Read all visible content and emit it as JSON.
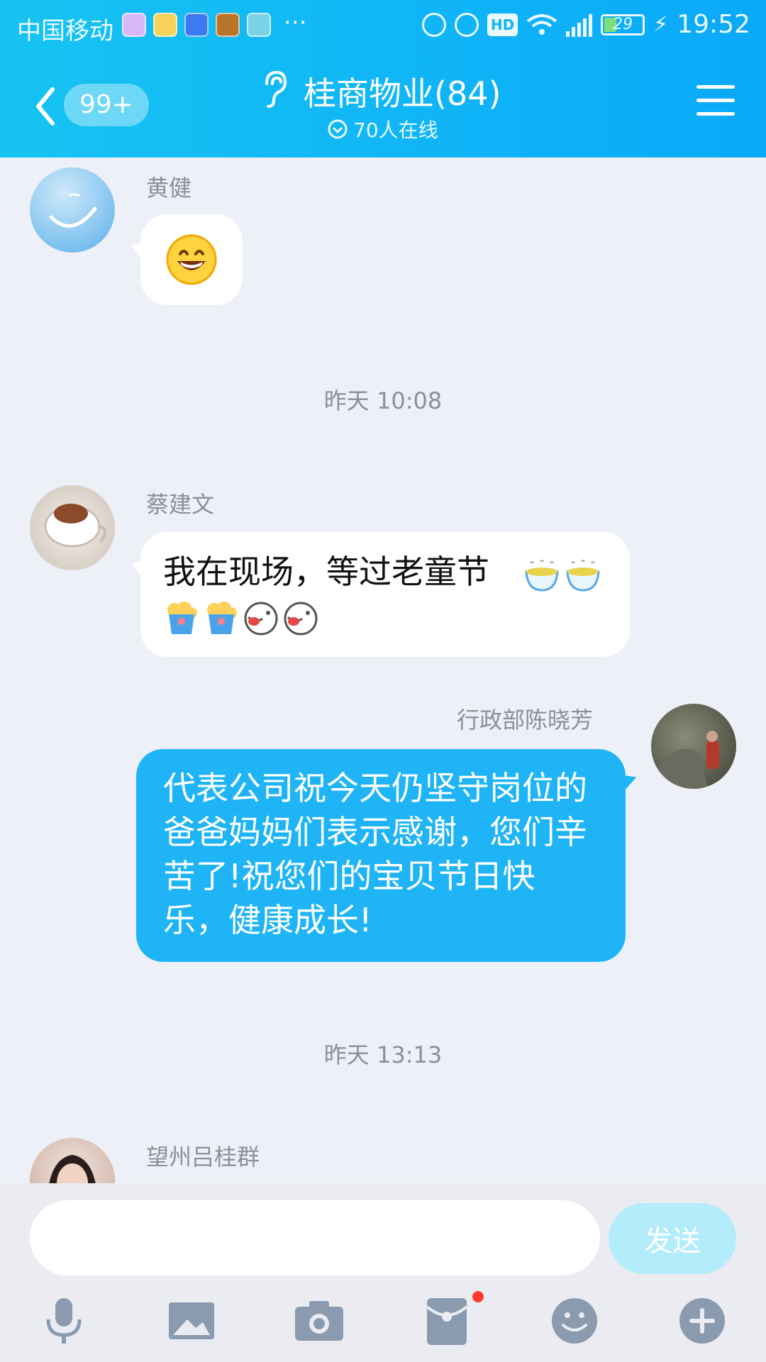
{
  "status_bar": {
    "carrier": "中国移动",
    "more": "···",
    "battery": "29",
    "time": "19:52",
    "hd": "HD"
  },
  "header": {
    "unread_badge": "99+",
    "title": "桂商物业(84)",
    "online": "70人在线"
  },
  "messages": [
    {
      "sender": "黄健",
      "type": "emoji",
      "direction": "in"
    },
    {
      "timestamp": "昨天 10:08"
    },
    {
      "sender": "蔡建文",
      "type": "text",
      "direction": "in",
      "text": "我在现场，等过老童节"
    },
    {
      "sender": "行政部陈晓芳",
      "type": "text",
      "direction": "out",
      "text": "代表公司祝今天仍坚守岗位的爸爸妈妈们表示感谢，您们辛苦了!祝您们的宝贝节日快乐，健康成长!"
    },
    {
      "timestamp": "昨天 13:13"
    },
    {
      "sender": "望州吕桂群",
      "direction": "in"
    }
  ],
  "input": {
    "placeholder": "",
    "send_label": "发送"
  },
  "toolbar": {
    "icons": [
      "mic-icon",
      "image-icon",
      "camera-icon",
      "red-packet-icon",
      "emoji-icon",
      "plus-icon"
    ]
  },
  "colors": {
    "header_start": "#17c3f2",
    "header_end": "#0aa9f8",
    "outgoing_bubble": "#1fb4f6",
    "chat_bg": "#eef0f7",
    "send_disabled": "#b3ecfb"
  }
}
